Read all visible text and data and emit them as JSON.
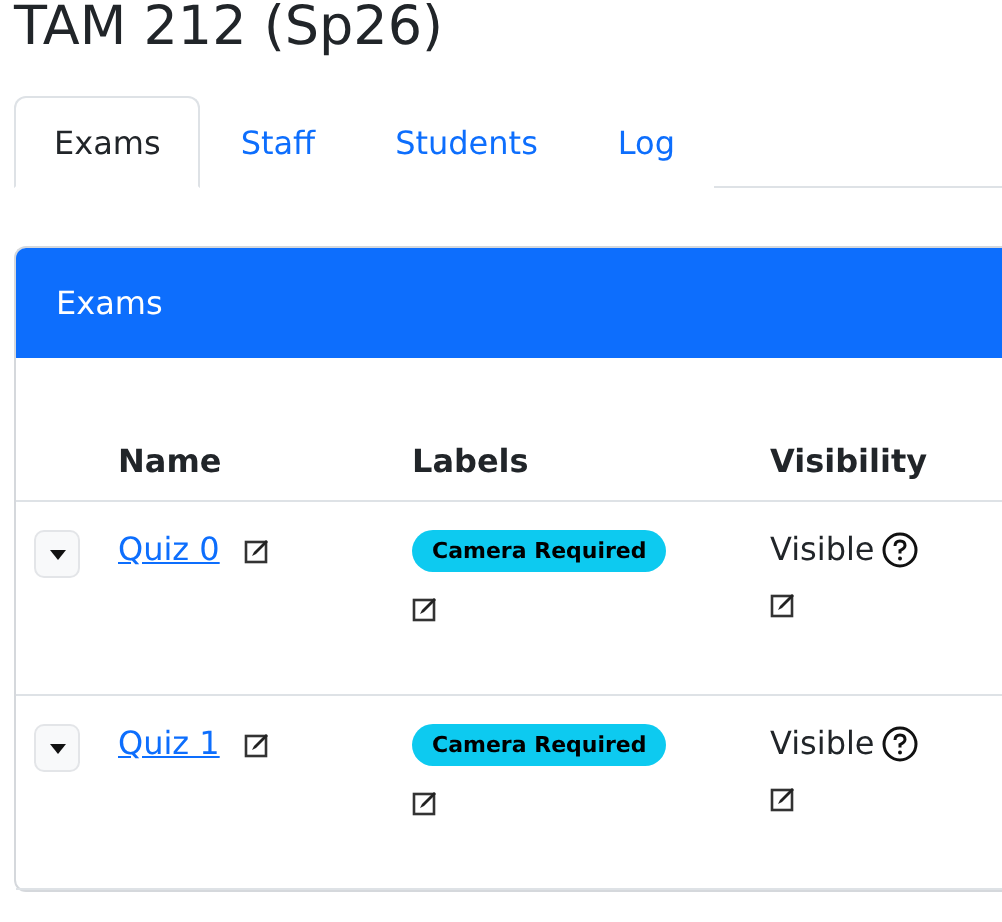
{
  "title": "TAM 212 (Sp26)",
  "tabs": [
    {
      "label": "Exams",
      "selected": true
    },
    {
      "label": "Staff",
      "selected": false
    },
    {
      "label": "Students",
      "selected": false
    },
    {
      "label": "Log",
      "selected": false
    }
  ],
  "card": {
    "title": "Exams"
  },
  "columns": [
    "Name",
    "Labels",
    "Visibility"
  ],
  "rows": [
    {
      "name": "Quiz 0",
      "labels": [
        "Camera Required"
      ],
      "visibility": "Visible"
    },
    {
      "name": "Quiz 1",
      "labels": [
        "Camera Required"
      ],
      "visibility": "Visible"
    }
  ]
}
